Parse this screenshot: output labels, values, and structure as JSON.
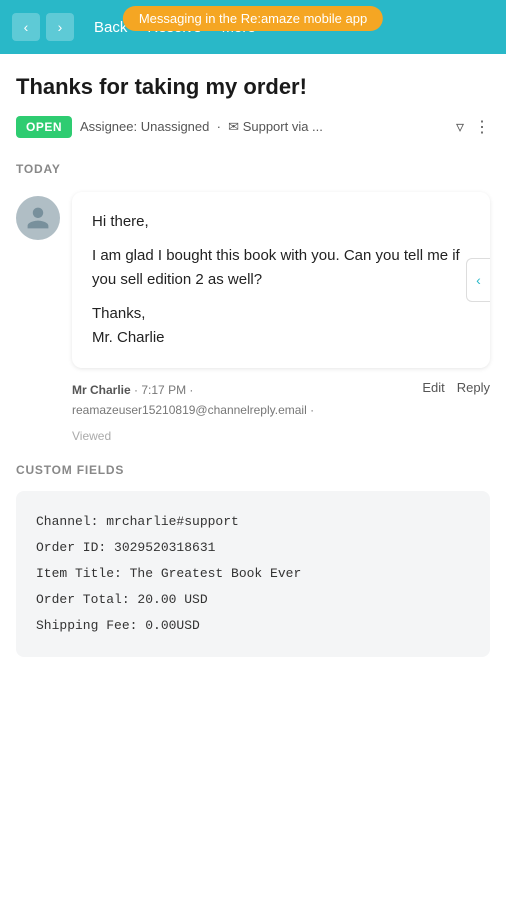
{
  "topbar": {
    "back_label": "Back",
    "resolve_label": "Resolve",
    "more_label": "More",
    "notification": "Messaging in the Re:amaze mobile app"
  },
  "page": {
    "title": "Thanks for taking my order!",
    "status_badge": "OPEN",
    "meta_assignee": "Assignee: Unassigned",
    "meta_support": "Support via ...",
    "section_today": "TODAY"
  },
  "message": {
    "greeting": "Hi there,",
    "body": "I am glad I bought this book with you. Can you tell me if you sell edition 2 as well?",
    "sign_off": "Thanks,",
    "name": "Mr. Charlie",
    "sender": "Mr Charlie",
    "time": "7:17 PM",
    "email": "reamazeuser15210819@channelreply.email",
    "viewed": "Viewed",
    "edit_label": "Edit",
    "reply_label": "Reply"
  },
  "custom_fields": {
    "label": "CUSTOM FIELDS",
    "channel": "Channel: mrcharlie#support",
    "order_id": "Order ID: 3029520318631",
    "item_title": "Item Title: The Greatest Book Ever",
    "order_total": "Order Total: 20.00 USD",
    "shipping_fee": "Shipping Fee: 0.00USD"
  }
}
